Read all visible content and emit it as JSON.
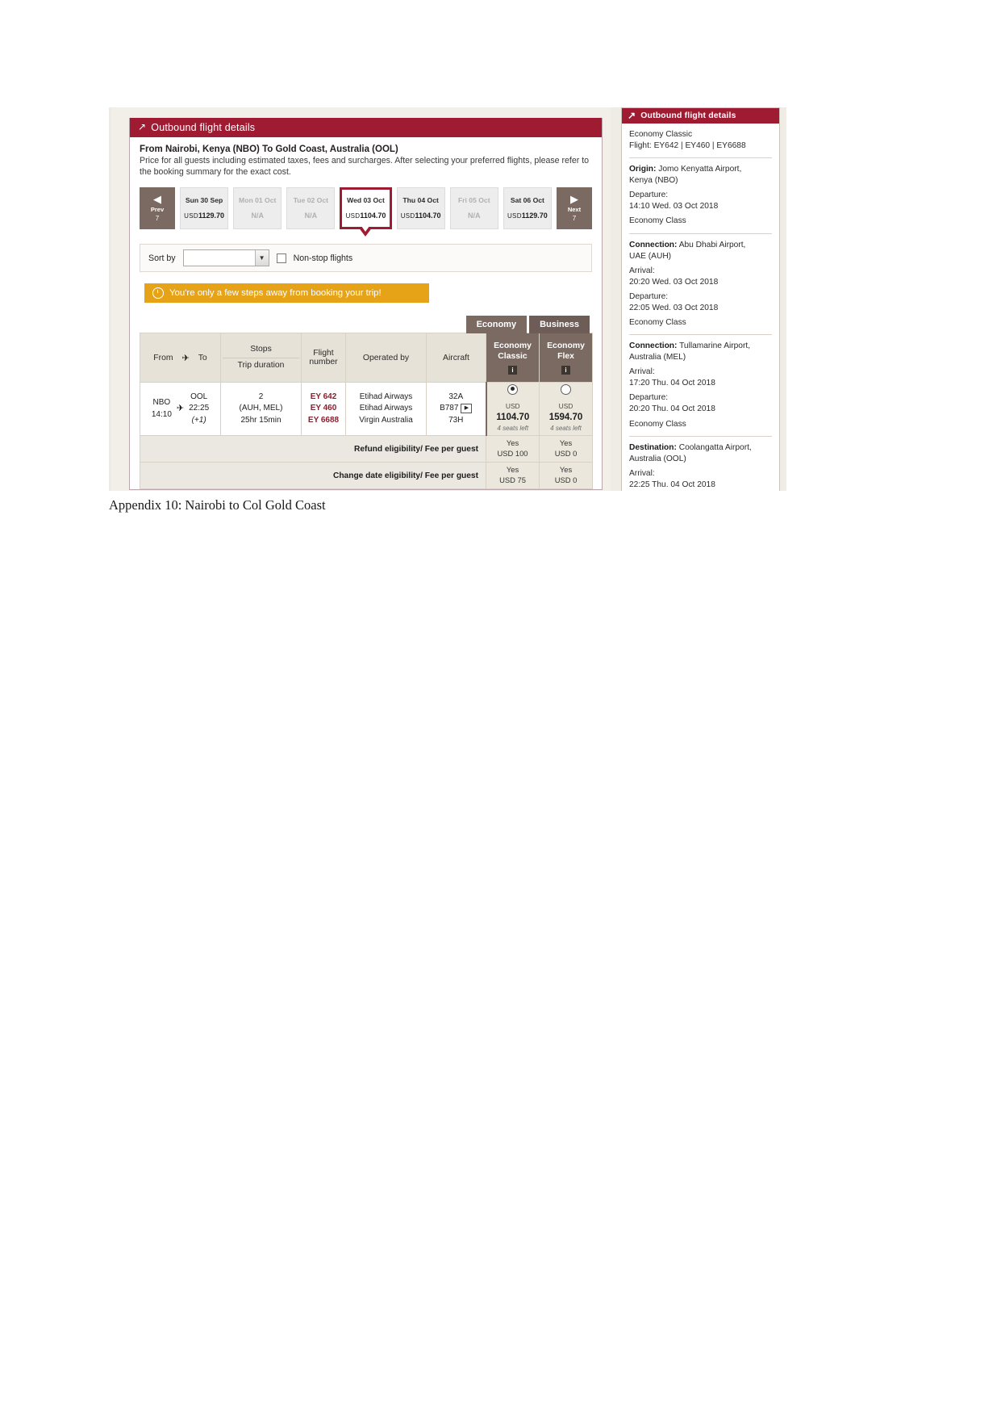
{
  "main": {
    "header": {
      "title": "Outbound flight details",
      "arrow_icon": "arrow-up-right-icon"
    },
    "route_title": "From Nairobi, Kenya (NBO) To Gold Coast, Australia (OOL)",
    "route_note": "Price for all guests including estimated taxes, fees and surcharges. After selecting your preferred flights, please refer to the booking summary for the exact cost.",
    "nav": {
      "prev_label": "Prev",
      "prev_count": "7",
      "prev_icon": "triangle-left-icon",
      "next_label": "Next",
      "next_count": "7",
      "next_icon": "triangle-right-icon"
    },
    "dates": [
      {
        "day": "Sun 30 Sep",
        "currency": "USD",
        "price": "1129.70",
        "state": "normal"
      },
      {
        "day": "Mon 01 Oct",
        "currency": "",
        "price": "N/A",
        "state": "dim"
      },
      {
        "day": "Tue 02 Oct",
        "currency": "",
        "price": "N/A",
        "state": "dim"
      },
      {
        "day": "Wed 03 Oct",
        "currency": "USD",
        "price": "1104.70",
        "state": "selected"
      },
      {
        "day": "Thu 04 Oct",
        "currency": "USD",
        "price": "1104.70",
        "state": "normal"
      },
      {
        "day": "Fri 05 Oct",
        "currency": "",
        "price": "N/A",
        "state": "dim"
      },
      {
        "day": "Sat 06 Oct",
        "currency": "USD",
        "price": "1129.70",
        "state": "normal"
      }
    ],
    "sortbar": {
      "label": "Sort by",
      "select_value": "",
      "select_icon": "chevron-down-icon",
      "nonstop_label": "Non-stop flights"
    },
    "banner": {
      "text": "You're only a few steps away from booking your trip!",
      "icon": "stopwatch-icon"
    },
    "tabs": [
      {
        "label": "Economy",
        "active": true
      },
      {
        "label": "Business",
        "active": false
      }
    ],
    "table": {
      "headers": {
        "from": "From",
        "plane_icon": "airplane-icon",
        "to": "To",
        "stops": "Stops",
        "trip_duration": "Trip duration",
        "flight": "Flight",
        "number": "number",
        "operated_by": "Operated by",
        "aircraft": "Aircraft",
        "fare1_l1": "Economy",
        "fare1_l2": "Classic",
        "fare2_l1": "Economy",
        "fare2_l2": "Flex",
        "info_icon": "info-icon"
      },
      "row": {
        "from_code": "NBO",
        "from_time": "14:10",
        "to_code": "OOL",
        "to_time": "22:25",
        "to_plus": "(+1)",
        "stops": "2",
        "stop_list": "(AUH, MEL)",
        "duration": "25hr 15min",
        "flight_numbers": [
          "EY 642",
          "EY 460",
          "EY 6688"
        ],
        "operators": [
          "Etihad Airways",
          "Etihad Airways",
          "Virgin Australia"
        ],
        "aircraft": [
          "32A",
          "B787",
          "73H"
        ],
        "aircraft_play_icon": "play-icon",
        "fare1": {
          "currency": "USD",
          "amount": "1104.70",
          "seats": "4 seats left",
          "selected": true
        },
        "fare2": {
          "currency": "USD",
          "amount": "1594.70",
          "seats": "4 seats left",
          "selected": false
        }
      },
      "eligibility": [
        {
          "label": "Refund eligibility/ Fee per guest",
          "fare1_yes": "Yes",
          "fare1_fee": "USD 100",
          "fare2_yes": "Yes",
          "fare2_fee": "USD 0"
        },
        {
          "label": "Change date eligibility/ Fee per guest",
          "fare1_yes": "Yes",
          "fare1_fee": "USD 75",
          "fare2_yes": "Yes",
          "fare2_fee": "USD 0"
        }
      ]
    }
  },
  "sidebar": {
    "header": {
      "title": "Outbound flight details",
      "arrow_icon": "arrow-up-right-icon"
    },
    "cabin": "Economy Classic",
    "flight_line": "Flight: EY642 | EY460 | EY6688",
    "segments": [
      {
        "place_label": "Origin:",
        "place_value": "Jomo Kenyatta Airport,",
        "place_value2": "Kenya (NBO)",
        "arrival_label": "",
        "arrival_value": "",
        "departure_label": "Departure:",
        "departure_value": "14:10 Wed. 03 Oct 2018",
        "cabin": "Economy Class"
      },
      {
        "place_label": "Connection:",
        "place_value": "Abu Dhabi Airport,",
        "place_value2": "UAE (AUH)",
        "arrival_label": "Arrival:",
        "arrival_value": "20:20 Wed. 03 Oct 2018",
        "departure_label": "Departure:",
        "departure_value": "22:05 Wed. 03 Oct 2018",
        "cabin": "Economy Class"
      },
      {
        "place_label": "Connection:",
        "place_value": "Tullamarine Airport,",
        "place_value2": "Australia (MEL)",
        "arrival_label": "Arrival:",
        "arrival_value": "17:20 Thu. 04 Oct 2018",
        "departure_label": "Departure:",
        "departure_value": "20:20 Thu. 04 Oct 2018",
        "cabin": "Economy Class"
      },
      {
        "place_label": "Destination:",
        "place_value": "Coolangatta Airport,",
        "place_value2": "Australia (OOL)",
        "arrival_label": "Arrival:",
        "arrival_value": "22:25 Thu. 04 Oct 2018",
        "departure_label": "",
        "departure_value": "",
        "cabin": ""
      }
    ]
  },
  "caption": "Appendix 10: Nairobi to Col Gold Coast",
  "colors": {
    "brand_red": "#9e1b32",
    "brown": "#7b6a62",
    "amber": "#e6a317"
  }
}
